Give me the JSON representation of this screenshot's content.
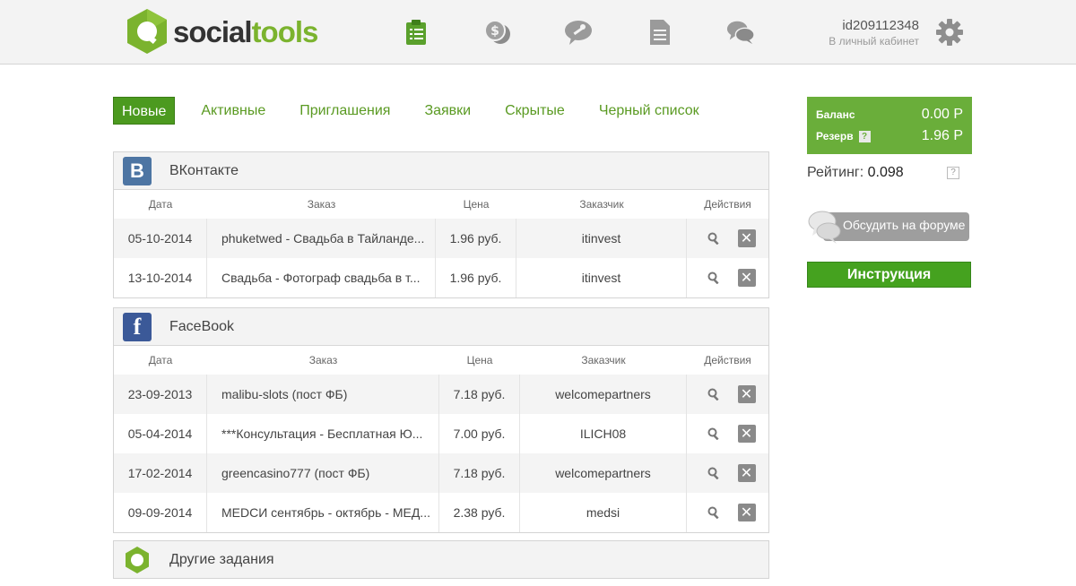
{
  "header": {
    "logo_part1": "social",
    "logo_part2": "tools",
    "user_id": "id209112348",
    "user_sub": "В личный кабинет",
    "nav_icons": [
      "clipboard-icon",
      "coins-icon",
      "wrench-bubble-icon",
      "document-icon",
      "chat-icon"
    ]
  },
  "tabs": [
    {
      "label": "Новые",
      "active": true
    },
    {
      "label": "Активные"
    },
    {
      "label": "Приглашения"
    },
    {
      "label": "Заявки"
    },
    {
      "label": "Скрытые"
    },
    {
      "label": "Черный список"
    }
  ],
  "columns": {
    "date": "Дата",
    "order": "Заказ",
    "price": "Цена",
    "client": "Заказчик",
    "actions": "Действия"
  },
  "vk": {
    "icon_letter": "B",
    "title": "ВКонтакте",
    "rows": [
      {
        "date": "05-10-2014",
        "order": "phuketwed - Свадьба в Тайланде...",
        "price": "1.96 руб.",
        "client": "itinvest"
      },
      {
        "date": "13-10-2014",
        "order": "Свадьба - Фотограф свадьба в т...",
        "price": "1.96 руб.",
        "client": "itinvest"
      }
    ]
  },
  "fb": {
    "icon_letter": "f",
    "title": "FaceBook",
    "rows": [
      {
        "date": "23-09-2013",
        "order": "malibu-slots (пост ФБ)",
        "price": "7.18 руб.",
        "client": "welcomepartners"
      },
      {
        "date": "05-04-2014",
        "order": "***Консультация - Бесплатная Ю...",
        "price": "7.00 руб.",
        "client": "ILICH08"
      },
      {
        "date": "17-02-2014",
        "order": "greencasino777 (пост ФБ)",
        "price": "7.18 руб.",
        "client": "welcomepartners"
      },
      {
        "date": "09-09-2014",
        "order": "MEDCИ сентябрь - октябрь - МЕД...",
        "price": "2.38 руб.",
        "client": "medsi"
      }
    ]
  },
  "other": {
    "title": "Другие задания"
  },
  "balance": {
    "balance_label": "Баланс",
    "balance_value": "0.00 Р",
    "reserve_label": "Резерв",
    "reserve_value": "1.96 Р",
    "help_mark": "?"
  },
  "rating": {
    "label": "Рейтинг:",
    "value": "0.098",
    "help_mark": "?"
  },
  "forum_button": "Обсудить на форуме",
  "instruction_button": "Инструкция",
  "colors": {
    "brand_green": "#7bb32e",
    "active_tab": "#4c9a1f",
    "balance_bg": "#6aae3a",
    "vk_blue": "#4d75a3",
    "fb_blue": "#3b5998"
  }
}
